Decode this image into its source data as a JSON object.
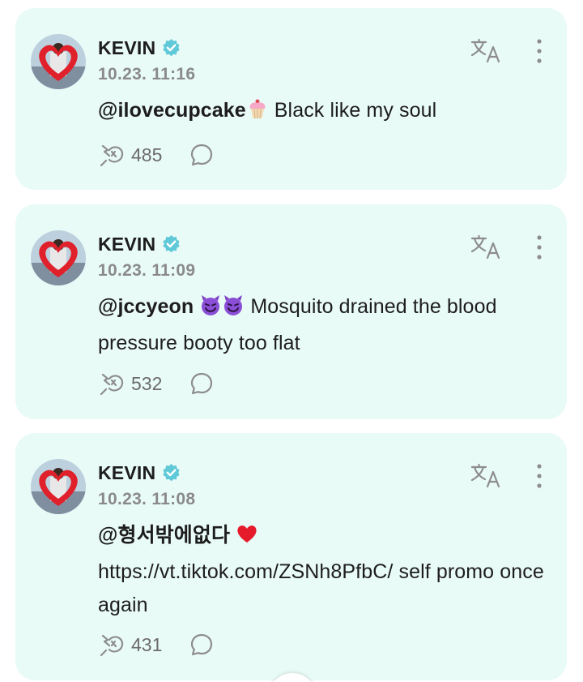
{
  "colors": {
    "card_bg": "#e9fbf7",
    "verified": "#5fc9d8",
    "icon_gray": "#8d8d8d"
  },
  "posts": [
    {
      "author": "KEVIN",
      "time": "10.23. 11:16",
      "mention": "@ilovecupcake",
      "emoji": "cupcake",
      "text_after": " Black like my soul",
      "repost_count": "485"
    },
    {
      "author": "KEVIN",
      "time": "10.23. 11:09",
      "mention": "@jccyeon",
      "emoji": "devils",
      "text_after": " Mosquito drained the blood pressure booty too flat",
      "repost_count": "532"
    },
    {
      "author": "KEVIN",
      "time": "10.23. 11:08",
      "mention": "@형서밖에없다",
      "emoji": "red-heart",
      "text_after": "https://vt.tiktok.com/ZSNh8PfbC/ self promo once again",
      "repost_count": "431"
    }
  ]
}
